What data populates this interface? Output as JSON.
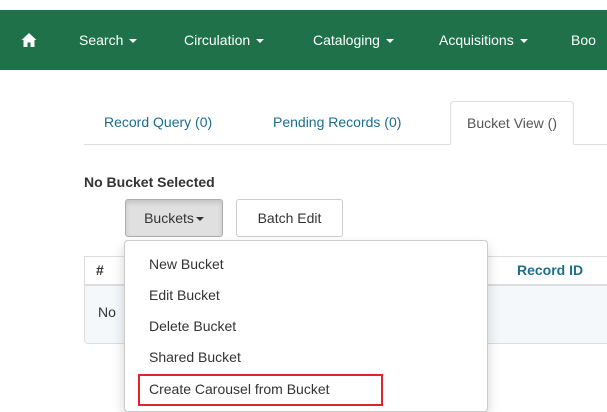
{
  "navbar": {
    "home_icon": "home-icon",
    "items": [
      {
        "label": "Search"
      },
      {
        "label": "Circulation"
      },
      {
        "label": "Cataloging"
      },
      {
        "label": "Acquisitions"
      },
      {
        "label": "Boo"
      }
    ]
  },
  "tabs": [
    {
      "label": "Record Query (0)"
    },
    {
      "label": "Pending Records (0)"
    },
    {
      "label": "Bucket View ()"
    }
  ],
  "heading": "No Bucket Selected",
  "buttons": {
    "buckets": "Buckets",
    "batch_edit": "Batch Edit"
  },
  "table": {
    "columns": [
      "#",
      "Record ID"
    ],
    "empty_prefix": "No"
  },
  "dropdown": {
    "items": [
      {
        "label": "New Bucket"
      },
      {
        "label": "Edit Bucket"
      },
      {
        "label": "Delete Bucket"
      },
      {
        "label": "Shared Bucket"
      },
      {
        "label": "Create Carousel from Bucket"
      }
    ]
  },
  "colors": {
    "navbar": "#1e7148",
    "link": "#1b6e8d",
    "highlight": "#e0242b"
  }
}
